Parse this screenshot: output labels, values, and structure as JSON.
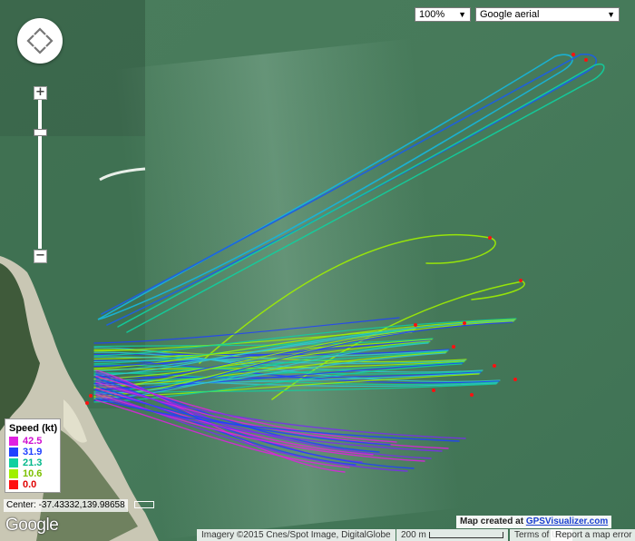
{
  "map": {
    "zoom_select": "100%",
    "layer_select": "Google aerial",
    "center_readout": "Center: -37.43332,139.98658",
    "logo": "Google",
    "imagery_credit": "Imagery ©2015 Cnes/Spot Image, DigitalGlobe",
    "scale_label": "200 m",
    "terms_label": "Terms of Use",
    "report_label": "Report a map error",
    "map_created_prefix": "Map created at",
    "map_created_link": "GPSVisualizer.com"
  },
  "legend": {
    "title": "Speed (kt)",
    "items": [
      {
        "label": "42.5",
        "color": "#e020e0"
      },
      {
        "label": "31.9",
        "color": "#2040ff"
      },
      {
        "label": "21.3",
        "color": "#10d0a0"
      },
      {
        "label": "10.6",
        "color": "#a0f000"
      },
      {
        "label": "0.0",
        "color": "#ff1010"
      }
    ]
  },
  "icons": [
    "pan-arrows-icon",
    "zoom-in-icon",
    "zoom-out-icon",
    "dropdown-arrow-icon"
  ]
}
